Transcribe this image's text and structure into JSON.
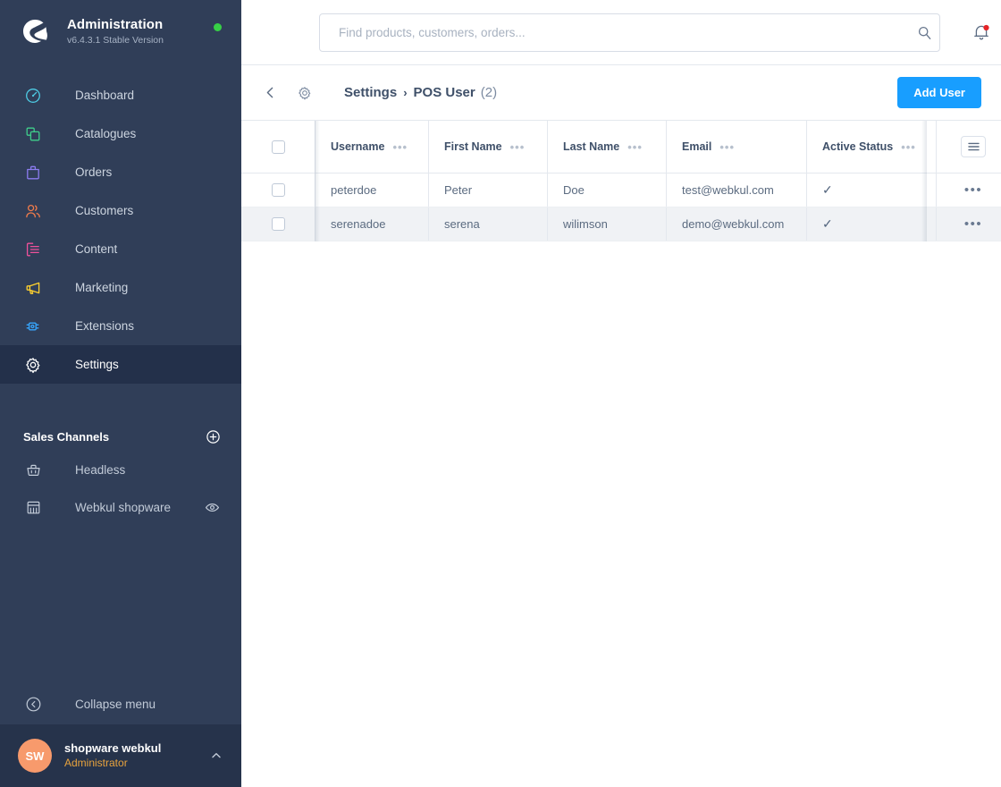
{
  "sidebar": {
    "brand": {
      "title": "Administration",
      "version": "v6.4.3.1 Stable Version",
      "logo_icon": "shopware-logo-icon",
      "status_dot_color": "#37D046"
    },
    "nav": [
      {
        "label": "Dashboard",
        "icon": "dashboard-icon",
        "color": "#4ECBE4",
        "active": false
      },
      {
        "label": "Catalogues",
        "icon": "catalogues-icon",
        "color": "#3FCE8B",
        "active": false
      },
      {
        "label": "Orders",
        "icon": "orders-icon",
        "color": "#8C7CF0",
        "active": false
      },
      {
        "label": "Customers",
        "icon": "customers-icon",
        "color": "#F07C4B",
        "active": false
      },
      {
        "label": "Content",
        "icon": "content-icon",
        "color": "#F0519B",
        "active": false
      },
      {
        "label": "Marketing",
        "icon": "marketing-icon",
        "color": "#FFD12E",
        "active": false
      },
      {
        "label": "Extensions",
        "icon": "extensions-icon",
        "color": "#37A7FF",
        "active": false
      },
      {
        "label": "Settings",
        "icon": "settings-gear-icon",
        "color": "#FFFFFF",
        "active": true
      }
    ],
    "sales_channels": {
      "title": "Sales Channels",
      "add_icon": "plus-circle-icon",
      "items": [
        {
          "label": "Headless",
          "icon": "basket-icon",
          "has_preview": false
        },
        {
          "label": "Webkul shopware",
          "icon": "storefront-icon",
          "has_preview": true,
          "preview_icon": "eye-icon"
        }
      ]
    },
    "collapse": {
      "label": "Collapse menu",
      "icon": "collapse-left-icon"
    },
    "profile": {
      "initials": "SW",
      "name": "shopware webkul",
      "role": "Administrator",
      "caret_icon": "chevron-up-icon",
      "avatar_color": "#F79A6C",
      "role_color": "#E8A33D"
    }
  },
  "topbar": {
    "search": {
      "placeholder": "Find products, customers, orders...",
      "value": "",
      "icon": "search-icon"
    },
    "notifications": {
      "icon": "bell-icon",
      "has_badge": true,
      "badge_color": "#E52427"
    }
  },
  "smartbar": {
    "back_icon": "chevron-left-icon",
    "gear_icon": "settings-gear-icon",
    "breadcrumb": {
      "parent": "Settings",
      "separator": "›",
      "current": "POS User",
      "count": "(2)"
    },
    "add_button": {
      "label": "Add User",
      "color": "#189EFF"
    }
  },
  "table": {
    "select_all_checked": false,
    "columns": [
      {
        "label": "Username",
        "menu_icon": "column-menu-icon"
      },
      {
        "label": "First Name",
        "menu_icon": "column-menu-icon"
      },
      {
        "label": "Last Name",
        "menu_icon": "column-menu-icon"
      },
      {
        "label": "Email",
        "menu_icon": "column-menu-icon"
      },
      {
        "label": "Active Status",
        "menu_icon": "column-menu-icon"
      }
    ],
    "settings_button_icon": "list-settings-icon",
    "row_actions_icon": "context-menu-icon",
    "active_mark": "✓",
    "rows": [
      {
        "username": "peterdoe",
        "first_name": "Peter",
        "last_name": "Doe",
        "email": "test@webkul.com",
        "active": true,
        "highlighted": false
      },
      {
        "username": "serenadoe",
        "first_name": "serena",
        "last_name": "wilimson",
        "email": "demo@webkul.com",
        "active": true,
        "highlighted": true
      }
    ]
  }
}
